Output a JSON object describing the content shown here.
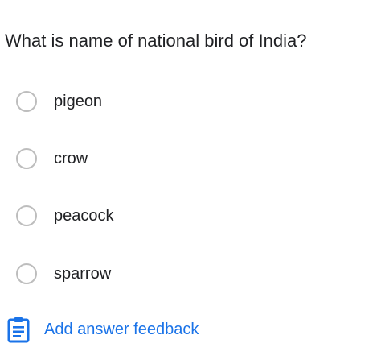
{
  "question": {
    "text": "What is name of national bird of India?"
  },
  "options": [
    {
      "label": "pigeon",
      "selected": false
    },
    {
      "label": "crow",
      "selected": false
    },
    {
      "label": "peacock",
      "selected": false
    },
    {
      "label": "sparrow",
      "selected": false
    }
  ],
  "feedback": {
    "label": "Add answer feedback",
    "icon": "clipboard-icon"
  },
  "colors": {
    "text": "#202124",
    "accent": "#1a73e8",
    "radio_border": "#bdbdbd"
  }
}
